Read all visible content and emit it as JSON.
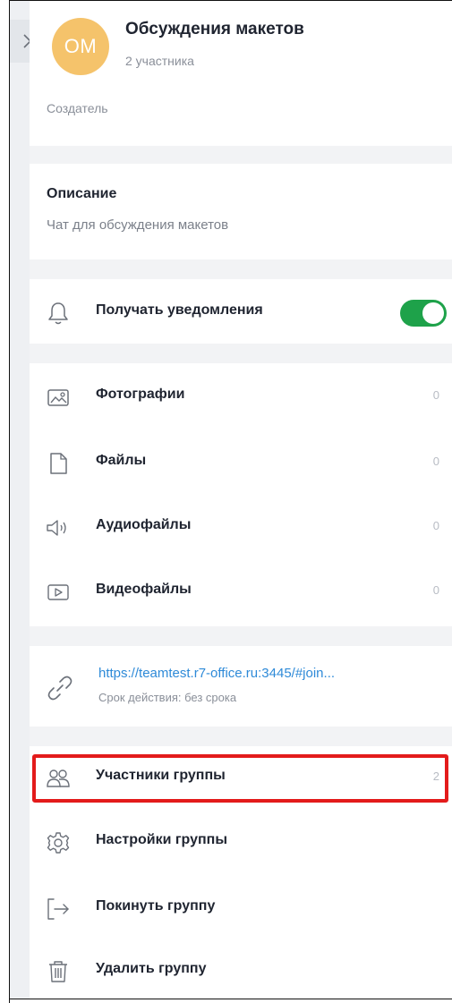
{
  "header": {
    "avatar_initials": "ОМ",
    "avatar_color": "#f5c36b",
    "title": "Обсуждения макетов",
    "members_count_text": "2 участника",
    "creator_label": "Создатель"
  },
  "description": {
    "heading": "Описание",
    "text": "Чат для обсуждения макетов"
  },
  "notifications": {
    "label": "Получать уведомления",
    "enabled": true,
    "toggle_color": "#1ea24a"
  },
  "media": [
    {
      "label": "Фотографии",
      "count": "0",
      "icon": "photo-icon"
    },
    {
      "label": "Файлы",
      "count": "0",
      "icon": "file-icon"
    },
    {
      "label": "Аудиофайлы",
      "count": "0",
      "icon": "audio-icon"
    },
    {
      "label": "Видеофайлы",
      "count": "0",
      "icon": "video-icon"
    }
  ],
  "invite_link": {
    "url": "https://teamtest.r7-office.ru:3445/#join...",
    "expiry": "Срок действия: без срока",
    "icon": "link-icon",
    "link_color": "#2e8ad8"
  },
  "actions": [
    {
      "label": "Участники группы",
      "count": "2",
      "icon": "members-icon",
      "highlighted": true
    },
    {
      "label": "Настройки группы",
      "icon": "gear-icon"
    },
    {
      "label": "Покинуть группу",
      "icon": "exit-icon"
    },
    {
      "label": "Удалить группу",
      "icon": "trash-icon"
    }
  ],
  "highlight_color": "#e31b1b"
}
